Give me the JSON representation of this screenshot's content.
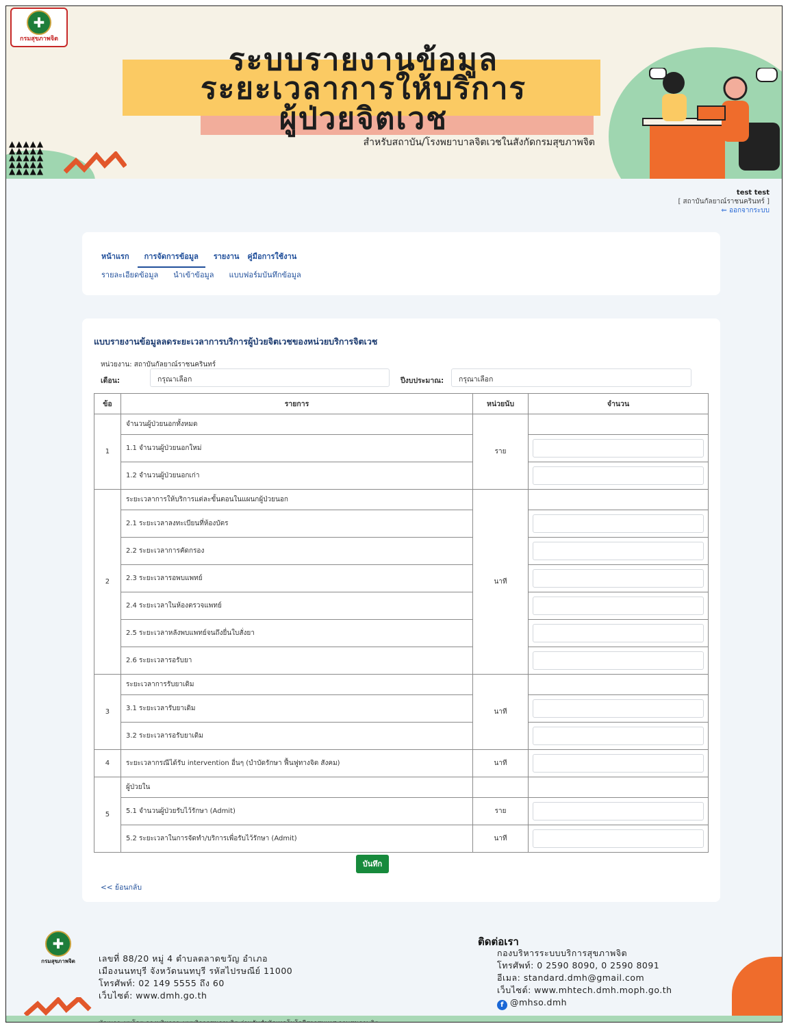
{
  "banner": {
    "logo_text": "กรมสุขภาพจิต",
    "title_line1": "ระบบรายงานข้อมูล",
    "title_line2": "ระยะเวลาการให้บริการ",
    "title_line3": "ผู้ป่วยจิตเวช",
    "subtitle": "สำหรับสถาบัน/โรงพยาบาลจิตเวชในสังกัดกรมสุขภาพจิต"
  },
  "user": {
    "name": "test test",
    "org": "[ สถาบันกัลยาณ์ราชนครินทร์ ]",
    "logout_label": "ออกจากระบบ"
  },
  "nav": {
    "main": [
      "หน้าแรก",
      "การจัดการข้อมูล",
      "รายงาน",
      "คู่มือการใช้งาน"
    ],
    "active_index": 1,
    "sub": [
      "รายละเอียดข้อมูล",
      "นำเข้าข้อมูล",
      "แบบฟอร์มบันทึกข้อมูล"
    ]
  },
  "form": {
    "title": "แบบรายงานข้อมูลลดระยะเวลาการบริการผู้ป่วยจิตเวชของหน่วยบริการจิตเวช",
    "unit_label": "หน่วยงาน: สถาบันกัลยาณ์ราชนครินทร์",
    "month_label": "เดือน:",
    "month_value": "กรุณาเลือก",
    "year_label": "ปีงบประมาณ:",
    "year_value": "กรุณาเลือก",
    "table": {
      "headers": [
        "ข้อ",
        "รายการ",
        "หน่วยนับ",
        "จำนวน"
      ],
      "groups": [
        {
          "no": "1",
          "unit": "ราย",
          "title": "จำนวนผู้ป่วยนอกทั้งหมด",
          "items": [
            "1.1 จำนวนผู้ป่วยนอกใหม่",
            "1.2 จำนวนผู้ป่วยนอกเก่า"
          ]
        },
        {
          "no": "2",
          "unit": "นาที",
          "title": "ระยะเวลาการให้บริการแต่ละขั้นตอนในแผนกผู้ป่วยนอก",
          "items": [
            "2.1 ระยะเวลาลงทะเบียนที่ห้องบัตร",
            "2.2 ระยะเวลาการคัดกรอง",
            "2.3 ระยะเวลารอพบแพทย์",
            "2.4 ระยะเวลาในห้องตรวจแพทย์",
            "2.5 ระยะเวลาหลังพบแพทย์จนถึงยื่นใบสั่งยา",
            "2.6 ระยะเวลารอรับยา"
          ]
        },
        {
          "no": "3",
          "unit": "นาที",
          "title": "ระยะเวลาการรับยาเดิม",
          "items": [
            "3.1 ระยะเวลารับยาเดิม",
            "3.2 ระยะเวลารอรับยาเดิม"
          ]
        },
        {
          "no": "4",
          "unit": "นาที",
          "title": "ระยะเวลากรณีได้รับ intervention อื่นๆ (บำบัดรักษา ฟื้นฟูทางจิต สังคม)"
        },
        {
          "no": "5",
          "title": "ผู้ป่วยใน",
          "items": [
            {
              "label": "5.1 จำนวนผู้ป่วยรับไว้รักษา (Admit)",
              "unit": "ราย"
            },
            {
              "label": "5.2 ระยะเวลาในการจัดทำ/บริการเพื่อรับไว้รักษา (Admit)",
              "unit": "นาที"
            }
          ]
        }
      ]
    },
    "save_label": "บันทึก",
    "back_label": "<< ย้อนกลับ"
  },
  "footer": {
    "logo_text": "กรมสุขภาพจิต",
    "address": [
      "เลขที่ 88/20 หมู่ 4 ตำบลตลาดขวัญ อำเภอ",
      "เมืองนนทบุรี จังหวัดนนทบุรี รหัสไปรษณีย์ 11000",
      "โทรศัพท์: 02 149 5555 ถึง 60",
      "เว็บไซต์: www.dmh.go.th"
    ],
    "contact_title": "ติดต่อเรา",
    "contact": [
      "กองบริหารระบบบริการสุขภาพจิต",
      "โทรศัพท์: 0 2590 8090, 0 2590 8091",
      "อีเมล: standard.dmh@gmail.com",
      "เว็บไซต์: www.mhtech.dmh.moph.go.th"
    ],
    "facebook": "@mhso.dmh",
    "bottom_bar": "พัฒนาระบบโดย กองบริหารระบบบริการสุขภาพจิต ร่วมกับสำนักเทคโนโลยีสารสนเทศ กรมสุขภาพจิต"
  },
  "colors": {
    "primary_link": "#1f4e9a",
    "save_button": "#178a3c",
    "banner_yellow": "#fbca63",
    "banner_green": "#9fd6b0",
    "accent_orange": "#ef6c2c"
  }
}
